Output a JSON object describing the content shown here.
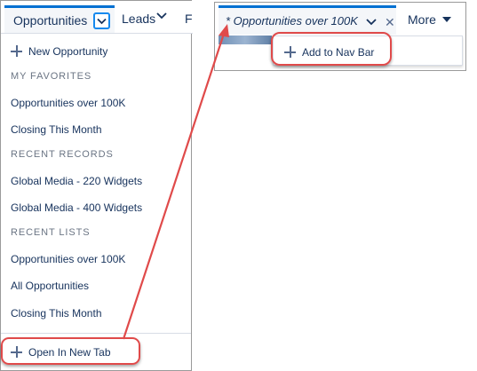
{
  "left_menu": {
    "nav": {
      "active_tab": "Opportunities",
      "second_tab": "Leads",
      "third_tab_partial": "F"
    },
    "new_item": "New Opportunity",
    "sections": [
      {
        "heading": "MY FAVORITES",
        "items": [
          "Opportunities over 100K",
          "Closing This Month"
        ]
      },
      {
        "heading": "RECENT RECORDS",
        "items": [
          "Global Media - 220 Widgets",
          "Global Media - 400 Widgets"
        ]
      },
      {
        "heading": "RECENT LISTS",
        "items": [
          "Opportunities over 100K",
          "All Opportunities",
          "Closing This Month"
        ]
      }
    ],
    "open_new_tab": "Open In New Tab"
  },
  "right_panel": {
    "tab_label": "* Opportunities over 100K",
    "more_label": "More",
    "dropdown_item": "Add to Nav Bar"
  },
  "colors": {
    "accent": "#0070d2",
    "highlight": "#e04a4a",
    "text": "#16325c",
    "muted": "#6b7584"
  },
  "icons": [
    "chevron-down-icon",
    "plus-icon",
    "close-icon",
    "caret-down-icon"
  ]
}
